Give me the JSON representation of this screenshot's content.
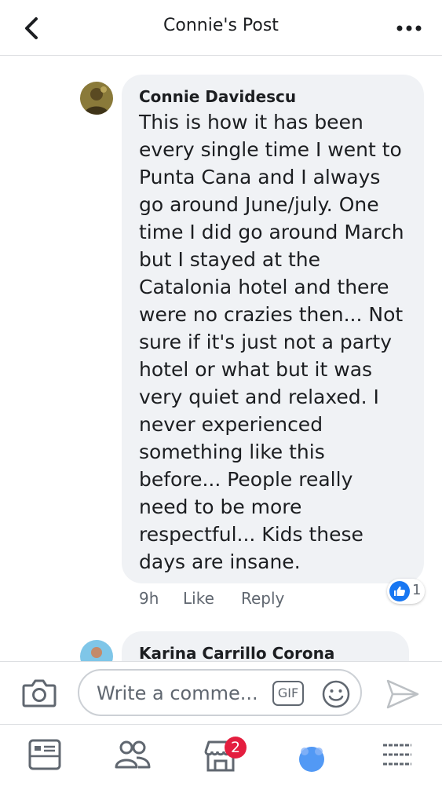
{
  "header": {
    "title": "Connie's Post",
    "back_icon": "chevron-left-icon",
    "more_icon": "more-horizontal-icon"
  },
  "comments": [
    {
      "author": "Connie Davidescu",
      "text": "This is how it has been\nevery single time I went to\nPunta Cana and I always\ngo around June/july. One\ntime I did go around March\nbut I stayed at the\nCatalonia hotel and there\nwere no crazies then... Not\nsure if it's just not a party\nhotel or what but it was\nvery quiet and relaxed. I\nnever experienced\nsomething like this\nbefore... People really\nneed to be more\nrespectful... Kids these\ndays are insane.",
      "time": "9h",
      "like_label": "Like",
      "reply_label": "Reply",
      "reaction_count": "1"
    },
    {
      "author": "Karina Carrillo Corona"
    }
  ],
  "composer": {
    "placeholder": "Write a comme...",
    "gif_label": "GIF"
  },
  "bottom_nav": {
    "marketplace_badge": "2"
  },
  "colors": {
    "accent": "#1877f2",
    "bubble": "#f0f2f5",
    "badge": "#e41e3f",
    "muted_text": "#606770"
  }
}
